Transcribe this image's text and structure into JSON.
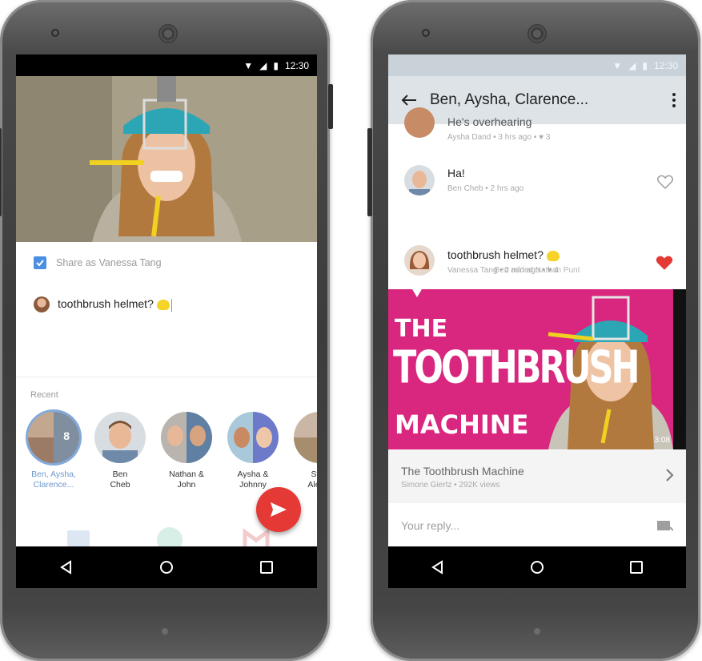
{
  "left_phone": {
    "status_time": "12:30",
    "share": {
      "checked": true,
      "label": "Share as Vanessa Tang"
    },
    "compose": {
      "text": "toothbrush helmet?"
    },
    "recent_label": "Recent",
    "contacts": [
      {
        "name": "Ben, Aysha,\nClarence...",
        "badge": "8",
        "selected": true
      },
      {
        "name": "Ben\nCheb",
        "selected": false
      },
      {
        "name": "Nathan &\nJohn",
        "selected": false
      },
      {
        "name": "Aysha &\nJohnny",
        "selected": false
      },
      {
        "name": "Stac\nAlejan",
        "selected": false
      }
    ],
    "send_icon": "send-icon",
    "accent_color": "#e53935"
  },
  "right_phone": {
    "status_time": "12:30",
    "appbar_title": "Ben, Aysha, Clarence...",
    "messages": [
      {
        "text": "He's overhearing",
        "meta": "Aysha Dand • 3 hrs ago • ♥ 3"
      },
      {
        "text": "Ha!",
        "meta": "Ben Cheb • 2 hrs ago",
        "liked": false
      },
      {
        "text": "toothbrush helmet?",
        "meta": "Vanessa Tang • 2 min ago • ♥ 4",
        "liked": true
      }
    ],
    "system_note": "Ben added Nathan Punt",
    "video": {
      "title_lines": [
        "THE",
        "TOOTHBRUSH",
        "MACHINE"
      ],
      "duration": "3:08"
    },
    "link": {
      "title": "The Toothbrush Machine",
      "subtitle": "Simone Giertz • 292K views"
    },
    "reply_placeholder": "Your reply...",
    "heart_color": "#e53935"
  }
}
